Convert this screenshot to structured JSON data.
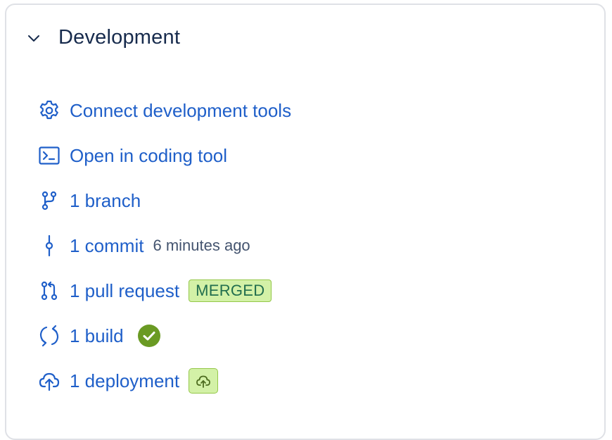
{
  "section": {
    "title": "Development"
  },
  "items": [
    {
      "label": "Connect development tools",
      "icon": "gear-icon"
    },
    {
      "label": "Open in coding tool",
      "icon": "terminal-icon"
    },
    {
      "label": "1 branch",
      "icon": "branch-icon"
    },
    {
      "label": "1 commit",
      "icon": "commit-icon",
      "meta": "6 minutes ago"
    },
    {
      "label": "1 pull request",
      "icon": "pull-request-icon",
      "badge": "MERGED"
    },
    {
      "label": "1 build",
      "icon": "build-icon",
      "status": "success-check-icon"
    },
    {
      "label": "1 deployment",
      "icon": "deployment-icon",
      "status": "cloud-upload-icon"
    }
  ],
  "colors": {
    "link": "#1f5fc9",
    "badge_bg": "#d3f1a7",
    "badge_border": "#94c748",
    "success": "#6a9a23"
  }
}
